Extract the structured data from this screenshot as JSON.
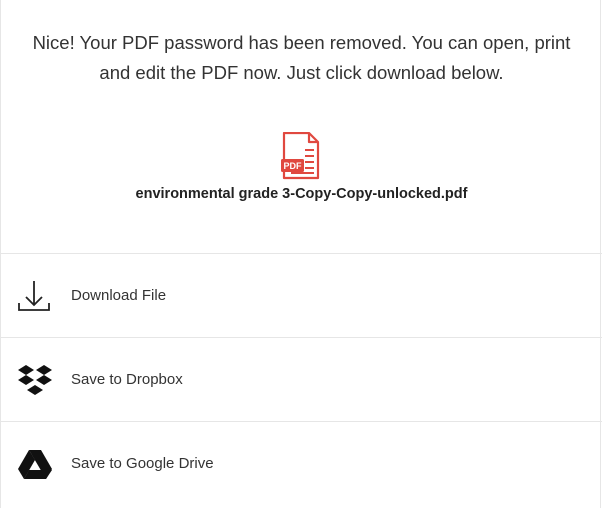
{
  "message": {
    "text": "Nice! Your PDF password has been removed. You can open, print\nand edit the PDF now. Just click download below."
  },
  "file": {
    "icon": "pdf-file-icon",
    "badge": "PDF",
    "name": "environmental grade 3-Copy-Copy-unlocked.pdf",
    "accent_color": "#e0483f"
  },
  "actions": [
    {
      "label": "Download File",
      "icon": "download-icon"
    },
    {
      "label": "Save to Dropbox",
      "icon": "dropbox-icon"
    },
    {
      "label": "Save to Google Drive",
      "icon": "google-drive-icon"
    }
  ]
}
